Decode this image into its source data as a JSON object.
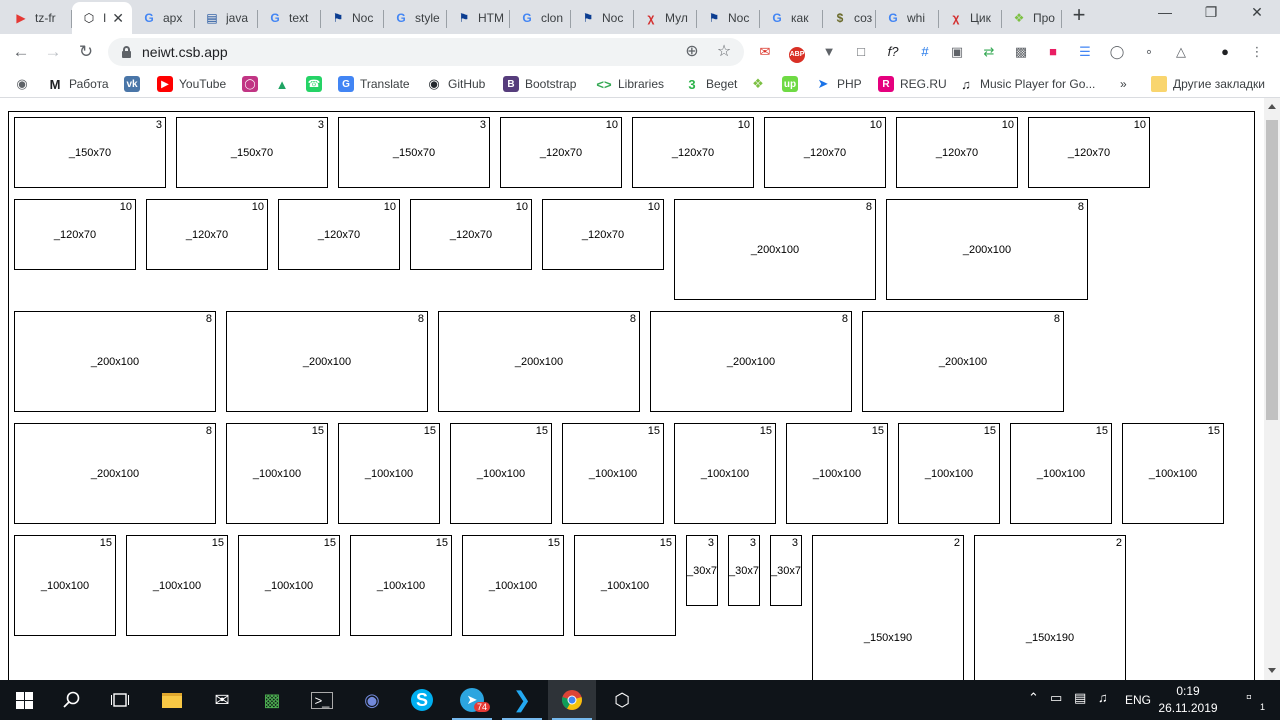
{
  "tabs": [
    {
      "title": "tz-fr",
      "icon": "youtube-red-icon",
      "active": false
    },
    {
      "title": "I",
      "icon": "codesandbox-icon",
      "active": true
    },
    {
      "title": "apx",
      "icon": "google-icon",
      "active": false
    },
    {
      "title": "java",
      "icon": "document-icon",
      "active": false
    },
    {
      "title": "text",
      "icon": "google-icon",
      "active": false
    },
    {
      "title": "Noc",
      "icon": "chat-bubble-icon",
      "active": false
    },
    {
      "title": "style",
      "icon": "google-icon",
      "active": false
    },
    {
      "title": "HTM",
      "icon": "chat-bubble-icon",
      "active": false
    },
    {
      "title": "clon",
      "icon": "google-icon",
      "active": false
    },
    {
      "title": "Noc",
      "icon": "chat-bubble-icon",
      "active": false
    },
    {
      "title": "Мул",
      "icon": "figure-icon",
      "active": false
    },
    {
      "title": "Noc",
      "icon": "chat-bubble-icon",
      "active": false
    },
    {
      "title": "как",
      "icon": "google-icon",
      "active": false
    },
    {
      "title": "соз",
      "icon": "dollar-icon",
      "active": false
    },
    {
      "title": "whi",
      "icon": "google-icon",
      "active": false
    },
    {
      "title": "Цик",
      "icon": "figure-icon",
      "active": false
    },
    {
      "title": "Про",
      "icon": "leaf-icon",
      "active": false
    }
  ],
  "address": {
    "url": "neiwt.csb.app"
  },
  "extensions_badge": "3248",
  "bookmarks": [
    {
      "label": "",
      "icon": "globe-icon",
      "color": "#5f6368"
    },
    {
      "label": "Работа",
      "icon": "m-icon",
      "color": "#202124"
    },
    {
      "label": "",
      "icon": "vk-icon",
      "color": "#4a76a8"
    },
    {
      "label": "YouTube",
      "icon": "youtube-icon",
      "color": "#ff0000"
    },
    {
      "label": "",
      "icon": "instagram-icon",
      "color": "#c13584"
    },
    {
      "label": "",
      "icon": "drive-icon",
      "color": "#1fa463"
    },
    {
      "label": "",
      "icon": "whatsapp-icon",
      "color": "#25d366"
    },
    {
      "label": "Translate",
      "icon": "translate-icon",
      "color": "#4285f4"
    },
    {
      "label": "GitHub",
      "icon": "github-icon",
      "color": "#24292e"
    },
    {
      "label": "Bootstrap",
      "icon": "bootstrap-icon",
      "color": "#563d7c"
    },
    {
      "label": "Libraries",
      "icon": "libraries-icon",
      "color": "#34a853"
    },
    {
      "label": "Beget",
      "icon": "beget-icon",
      "color": "#2cb34a"
    },
    {
      "label": "",
      "icon": "leaf-icon",
      "color": "#7cc043"
    },
    {
      "label": "",
      "icon": "up-icon",
      "color": "#6fda44"
    },
    {
      "label": "PHP",
      "icon": "php-icon",
      "color": "#1a73e8"
    },
    {
      "label": "REG.RU",
      "icon": "regru-icon",
      "color": "#e5007e"
    },
    {
      "label": "Music Player for Go...",
      "icon": "headphones-icon",
      "color": "#202124"
    }
  ],
  "bookmarks_more": "»",
  "other_bookmarks": "Другие закладки",
  "boxes": [
    {
      "label": "_150x70",
      "count": "3"
    },
    {
      "label": "_150x70",
      "count": "3"
    },
    {
      "label": "_150x70",
      "count": "3"
    },
    {
      "label": "_120x70",
      "count": "10"
    },
    {
      "label": "_120x70",
      "count": "10"
    },
    {
      "label": "_120x70",
      "count": "10"
    },
    {
      "label": "_120x70",
      "count": "10"
    },
    {
      "label": "_120x70",
      "count": "10"
    },
    {
      "label": "_120x70",
      "count": "10"
    },
    {
      "label": "_120x70",
      "count": "10"
    },
    {
      "label": "_120x70",
      "count": "10"
    },
    {
      "label": "_120x70",
      "count": "10"
    },
    {
      "label": "_120x70",
      "count": "10"
    },
    {
      "label": "_200x100",
      "count": "8"
    },
    {
      "label": "_200x100",
      "count": "8"
    },
    {
      "label": "_200x100",
      "count": "8"
    },
    {
      "label": "_200x100",
      "count": "8"
    },
    {
      "label": "_200x100",
      "count": "8"
    },
    {
      "label": "_200x100",
      "count": "8"
    },
    {
      "label": "_200x100",
      "count": "8"
    },
    {
      "label": "_200x100",
      "count": "8"
    },
    {
      "label": "_100x100",
      "count": "15"
    },
    {
      "label": "_100x100",
      "count": "15"
    },
    {
      "label": "_100x100",
      "count": "15"
    },
    {
      "label": "_100x100",
      "count": "15"
    },
    {
      "label": "_100x100",
      "count": "15"
    },
    {
      "label": "_100x100",
      "count": "15"
    },
    {
      "label": "_100x100",
      "count": "15"
    },
    {
      "label": "_100x100",
      "count": "15"
    },
    {
      "label": "_100x100",
      "count": "15"
    },
    {
      "label": "_100x100",
      "count": "15"
    },
    {
      "label": "_100x100",
      "count": "15"
    },
    {
      "label": "_100x100",
      "count": "15"
    },
    {
      "label": "_100x100",
      "count": "15"
    },
    {
      "label": "_100x100",
      "count": "15"
    },
    {
      "label": "_100x100",
      "count": "15"
    },
    {
      "label": "_30x70",
      "count": "3"
    },
    {
      "label": "_30x70",
      "count": "3"
    },
    {
      "label": "_30x70",
      "count": "3"
    },
    {
      "label": "_150x190",
      "count": "2"
    },
    {
      "label": "_150x190",
      "count": "2"
    }
  ],
  "taskbar": {
    "language": "ENG",
    "time": "0:19",
    "date": "26.11.2019",
    "telegram_badge": "74",
    "notifications": "1"
  }
}
